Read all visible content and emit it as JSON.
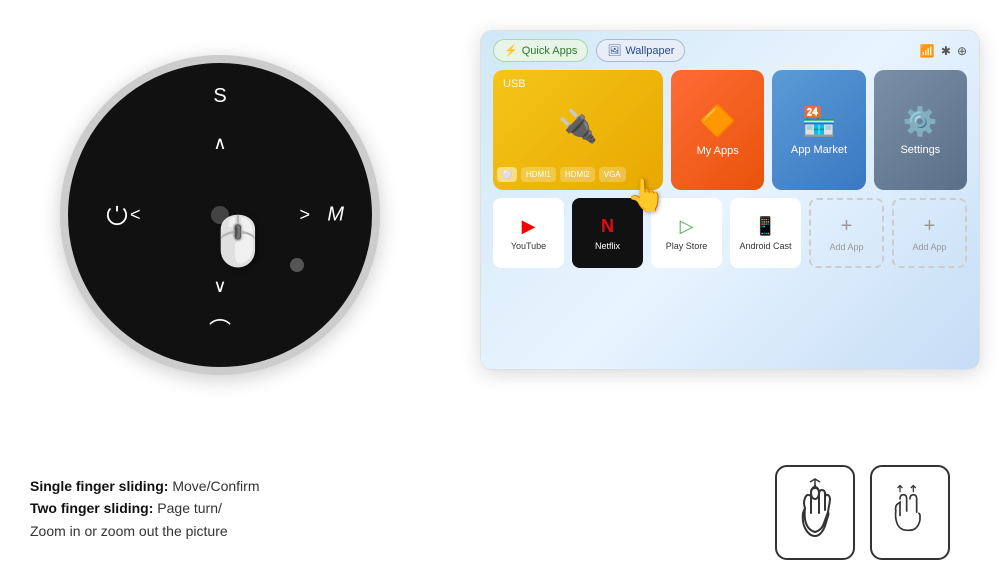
{
  "remote": {
    "labels": {
      "s": "S",
      "up": "∧",
      "left": "<",
      "right": ">",
      "down": "∨",
      "back": "⌒",
      "m": "M"
    }
  },
  "tv": {
    "tabs": [
      {
        "id": "quick-apps",
        "label": "Quick Apps"
      },
      {
        "id": "wallpaper",
        "label": "Wallpaper"
      }
    ],
    "row1": [
      {
        "id": "usb",
        "label": "USB",
        "icon": "🔌"
      },
      {
        "id": "my-apps",
        "label": "My Apps",
        "icon": "🔶"
      },
      {
        "id": "app-market",
        "label": "App Market",
        "icon": "🏪"
      },
      {
        "id": "settings",
        "label": "Settings",
        "icon": "⚙️"
      }
    ],
    "row2": [
      {
        "id": "youtube",
        "label": "YouTube",
        "icon": "▶"
      },
      {
        "id": "netflix",
        "label": "Netflix",
        "icon": "N"
      },
      {
        "id": "play-store",
        "label": "Play Store",
        "icon": "▷"
      },
      {
        "id": "android-cast",
        "label": "Android Cast",
        "icon": "📱"
      },
      {
        "id": "add-app-1",
        "label": "Add App",
        "icon": "+"
      },
      {
        "id": "add-app-2",
        "label": "Add App",
        "icon": "+"
      }
    ],
    "sources": [
      "🔵",
      "HDMI1",
      "HDMI2",
      "VGA"
    ]
  },
  "instructions": {
    "line1_bold": "Single finger sliding:",
    "line1_rest": " Move/Confirm",
    "line2_bold": "Two finger sliding:",
    "line2_rest": " Page turn/\nZoom in or zoom out the picture"
  }
}
